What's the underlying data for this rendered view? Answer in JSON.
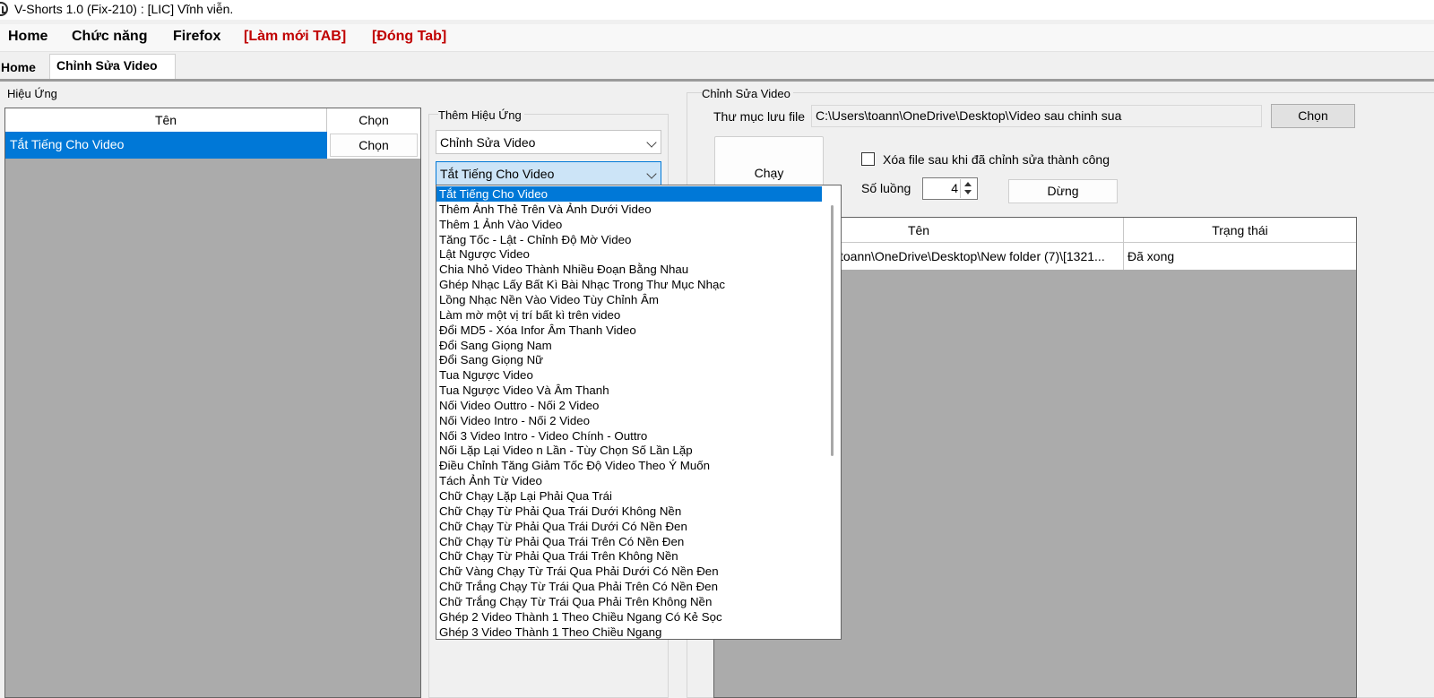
{
  "window": {
    "title": "V-Shorts 1.0 (Fix-210) : [LIC] Vĩnh viễn."
  },
  "menu": {
    "home": "Home",
    "functions": "Chức năng",
    "firefox": "Firefox",
    "refresh_tab": "[Làm mới TAB]",
    "close_tab": "[Đóng Tab]"
  },
  "tabs": {
    "home": "Home",
    "edit_video": "Chỉnh Sửa Video"
  },
  "effects": {
    "group_title": "Hiệu Ứng",
    "col_name": "Tên",
    "col_choose": "Chọn",
    "rows": [
      {
        "name": "Tắt Tiếng Cho Video",
        "button": "Chọn"
      }
    ]
  },
  "add_effect": {
    "group_title": "Thêm Hiệu Ứng",
    "category_value": "Chỉnh Sửa Video",
    "effect_value": "Tắt Tiếng Cho Video",
    "options": [
      "Tắt Tiếng Cho Video",
      "Thêm Ảnh Thẻ Trên Và Ảnh Dưới Video",
      "Thêm 1 Ảnh Vào Video",
      "Tăng Tốc - Lật - Chỉnh Độ Mờ Video",
      "Lật Ngược Video",
      "Chia Nhỏ Video Thành Nhiều Đoạn Bằng Nhau",
      "Ghép Nhạc Lấy Bất Kì Bài Nhạc Trong Thư Mục Nhạc",
      "Lồng Nhạc Nền Vào Video Tùy Chỉnh Âm",
      "Làm mờ một vị trí bất kì trên video",
      "Đổi MD5 - Xóa Infor Âm Thanh Video",
      "Đổi Sang Giọng Nam",
      "Đổi Sang Giọng Nữ",
      "Tua Ngược Video",
      "Tua Ngược Video Và Âm Thanh",
      "Nối Video Outtro - Nối 2 Video",
      "Nối Video Intro - Nối 2 Video",
      "Nối 3 Video Intro - Video Chính - Outtro",
      "Nối Lặp Lại Video n Lần - Tùy Chọn Số Lần Lặp",
      "Điều Chỉnh Tăng Giảm Tốc Độ Video Theo Ý Muốn",
      "Tách Ảnh Từ Video",
      "Chữ Chạy Lặp Lại Phải Qua Trái",
      "Chữ Chạy Từ Phải Qua Trái Dưới Không Nền",
      "Chữ Chạy Từ Phải Qua Trái Dưới Có Nền Đen",
      "Chữ Chạy Từ Phải Qua Trái Trên Có Nền Đen",
      "Chữ Chạy Từ Phải Qua Trái Trên Không Nền",
      "Chữ Vàng Chạy Từ  Trái Qua Phải Dưới Có Nền Đen",
      "Chữ Trắng Chạy Từ Trái Qua Phải Trên Có Nền Đen",
      "Chữ Trắng Chạy Từ Trái Qua Phải Trên Không Nền",
      "Ghép 2 Video Thành 1 Theo Chiều Ngang Có Kẻ Sọc",
      "Ghép 3 Video Thành 1 Theo Chiều Ngang"
    ]
  },
  "edit": {
    "group_title": "Chỉnh Sửa Video",
    "output_label": "Thư mục lưu file",
    "output_path": "C:\\Users\\toann\\OneDrive\\Desktop\\Video sau chinh sua",
    "choose_button": "Chọn",
    "run_button": "Chạy",
    "delete_after_label": "Xóa file sau khi đã chỉnh sửa thành công",
    "delete_after_checked": false,
    "threads_label": "Số luồng",
    "threads_value": "4",
    "stop_button": "Dừng",
    "table": {
      "col_name": "Tên",
      "col_status": "Trạng thái",
      "rows": [
        {
          "name": "toann\\OneDrive\\Desktop\\New folder (7)\\[1321...",
          "status": "Đã xong"
        }
      ]
    }
  },
  "colors": {
    "selection": "#0078d7",
    "menu_red": "#c00000",
    "grid_bg": "#ababab"
  }
}
